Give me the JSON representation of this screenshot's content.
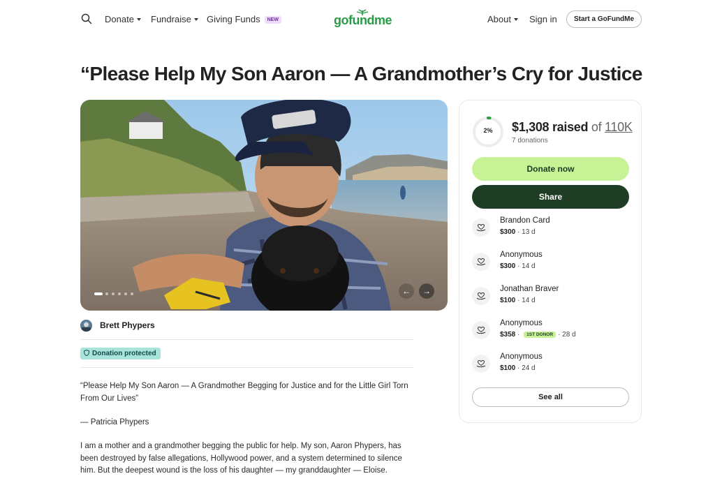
{
  "header": {
    "nav_left": [
      {
        "label": "Donate"
      },
      {
        "label": "Fundraise"
      },
      {
        "label": "Giving Funds",
        "badge": "NEW"
      }
    ],
    "logo_text": "gofundme",
    "nav_right": [
      {
        "label": "About"
      },
      {
        "label": "Sign in"
      }
    ],
    "cta_label": "Start a GoFundMe"
  },
  "campaign": {
    "title": "“Please Help My Son Aaron — A Grandmother’s Cry for Justice",
    "organizer": "Brett Phypers",
    "protection_badge": "Donation protected",
    "story": [
      "“Please Help My Son Aaron — A Grandmother Begging for Justice and for the Little Girl Torn From Our Lives”",
      "— Patricia Phypers",
      "I am a mother and a grandmother begging the public for help. My son, Aaron Phypers, has been destroyed by false allegations, Hollywood power, and a system determined to silence him. But the deepest wound is the loss of his daughter — my granddaughter — Eloise."
    ],
    "carousel": {
      "current": 1,
      "total": 6
    }
  },
  "progress": {
    "percent_label": "2%",
    "percent": 0.02,
    "raised": "$1,308 raised",
    "of_text": "of",
    "goal": "110K",
    "donations_count": "7 donations",
    "donate_label": "Donate now",
    "share_label": "Share",
    "see_all_label": "See all",
    "accent_color": "#c8f296",
    "dark_color": "#1f3d24"
  },
  "donations": [
    {
      "name": "Brandon Card",
      "amount": "$300",
      "time": "13 d",
      "badge": ""
    },
    {
      "name": "Anonymous",
      "amount": "$300",
      "time": "14 d",
      "badge": ""
    },
    {
      "name": "Jonathan Braver",
      "amount": "$100",
      "time": "14 d",
      "badge": ""
    },
    {
      "name": "Anonymous",
      "amount": "$358",
      "time": "28 d",
      "badge": "1ST DONOR"
    },
    {
      "name": "Anonymous",
      "amount": "$100",
      "time": "24 d",
      "badge": ""
    }
  ],
  "icons": {
    "search": "search-icon",
    "donation": "heart-hand-icon",
    "shield": "shield-icon",
    "next": "arrow-right-icon",
    "prev": "arrow-left-icon"
  }
}
